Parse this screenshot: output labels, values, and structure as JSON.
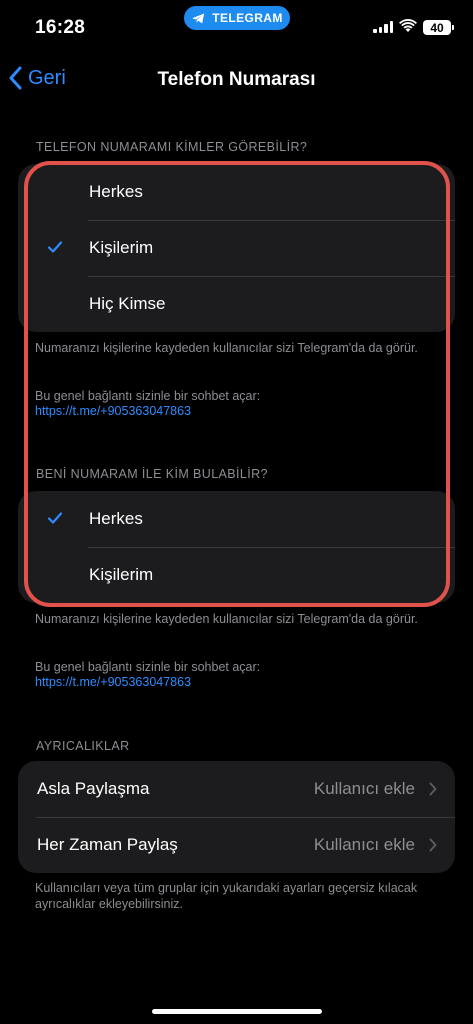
{
  "status_bar": {
    "time": "16:28",
    "pill_label": "TELEGRAM",
    "battery": "40"
  },
  "nav": {
    "back_label": "Geri",
    "title": "Telefon Numarası"
  },
  "section1": {
    "header": "TELEFON NUMARAMI KİMLER GÖREBİLİR?",
    "options": [
      {
        "label": "Herkes",
        "checked": false
      },
      {
        "label": "Kişilerim",
        "checked": true
      },
      {
        "label": "Hiç Kimse",
        "checked": false
      }
    ],
    "note": "Numaranızı kişilerine kaydeden kullanıcılar sizi Telegram'da da görür.",
    "link_note": "Bu genel bağlantı sizinle bir sohbet açar:",
    "link": "https://t.me/+905363047863"
  },
  "section2": {
    "header": "BENİ NUMARAM İLE KİM BULABİLİR?",
    "options": [
      {
        "label": "Herkes",
        "checked": true
      },
      {
        "label": "Kişilerim",
        "checked": false
      }
    ],
    "note": "Numaranızı kişilerine kaydeden kullanıcılar sizi Telegram'da da görür.",
    "link_note": "Bu genel bağlantı sizinle bir sohbet açar:",
    "link": "https://t.me/+905363047863"
  },
  "exceptions": {
    "header": "AYRICALIKLAR",
    "rows": [
      {
        "label": "Asla Paylaşma",
        "value": "Kullanıcı ekle"
      },
      {
        "label": "Her Zaman Paylaş",
        "value": "Kullanıcı ekle"
      }
    ],
    "note": "Kullanıcıları veya tüm gruplar için yukarıdaki ayarları geçersiz kılacak ayrıcalıklar ekleyebilirsiniz."
  },
  "colors": {
    "accent": "#2f8cff",
    "highlight": "#e0524b",
    "cell": "#1c1c1e",
    "secondary_text": "#8d8d93"
  }
}
